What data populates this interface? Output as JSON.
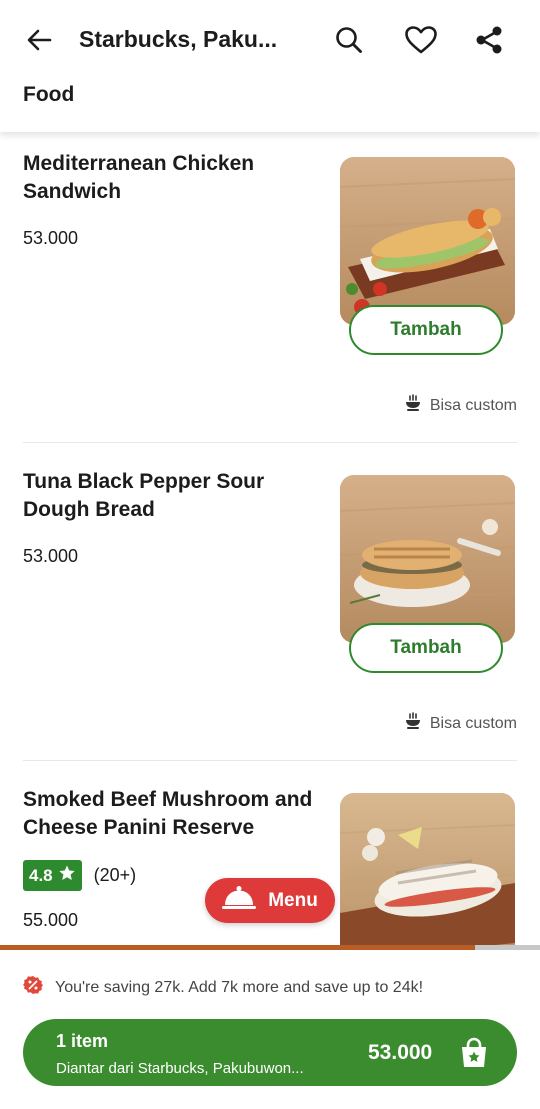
{
  "header": {
    "title": "Starbucks, Paku...",
    "section": "Food"
  },
  "items": [
    {
      "name": "Mediterranean Chicken Sandwich",
      "price": "53.000",
      "add_label": "Tambah",
      "custom_label": "Bisa custom"
    },
    {
      "name": "Tuna Black Pepper Sour Dough Bread",
      "price": "53.000",
      "add_label": "Tambah",
      "custom_label": "Bisa custom"
    },
    {
      "name": "Smoked Beef Mushroom and Cheese Panini Reserve",
      "rating": "4.8",
      "rating_count": "(20+)",
      "price": "55.000"
    }
  ],
  "menu_button": {
    "label": "Menu"
  },
  "progress": {
    "fraction": 0.88
  },
  "savings": {
    "text": "You're saving 27k. Add 7k more and save up to 24k!"
  },
  "cart": {
    "count": "1 item",
    "from": "Diantar dari  Starbucks, Pakubuwon...",
    "total": "53.000"
  },
  "colors": {
    "brand_green": "#2e8a2e",
    "menu_red": "#de3a3a",
    "progress": "#b85d24"
  },
  "icons": [
    "back-arrow-icon",
    "search-icon",
    "heart-icon",
    "share-icon",
    "custom-bowl-icon",
    "star-icon",
    "cloche-icon",
    "discount-icon",
    "shopping-bag-icon"
  ]
}
